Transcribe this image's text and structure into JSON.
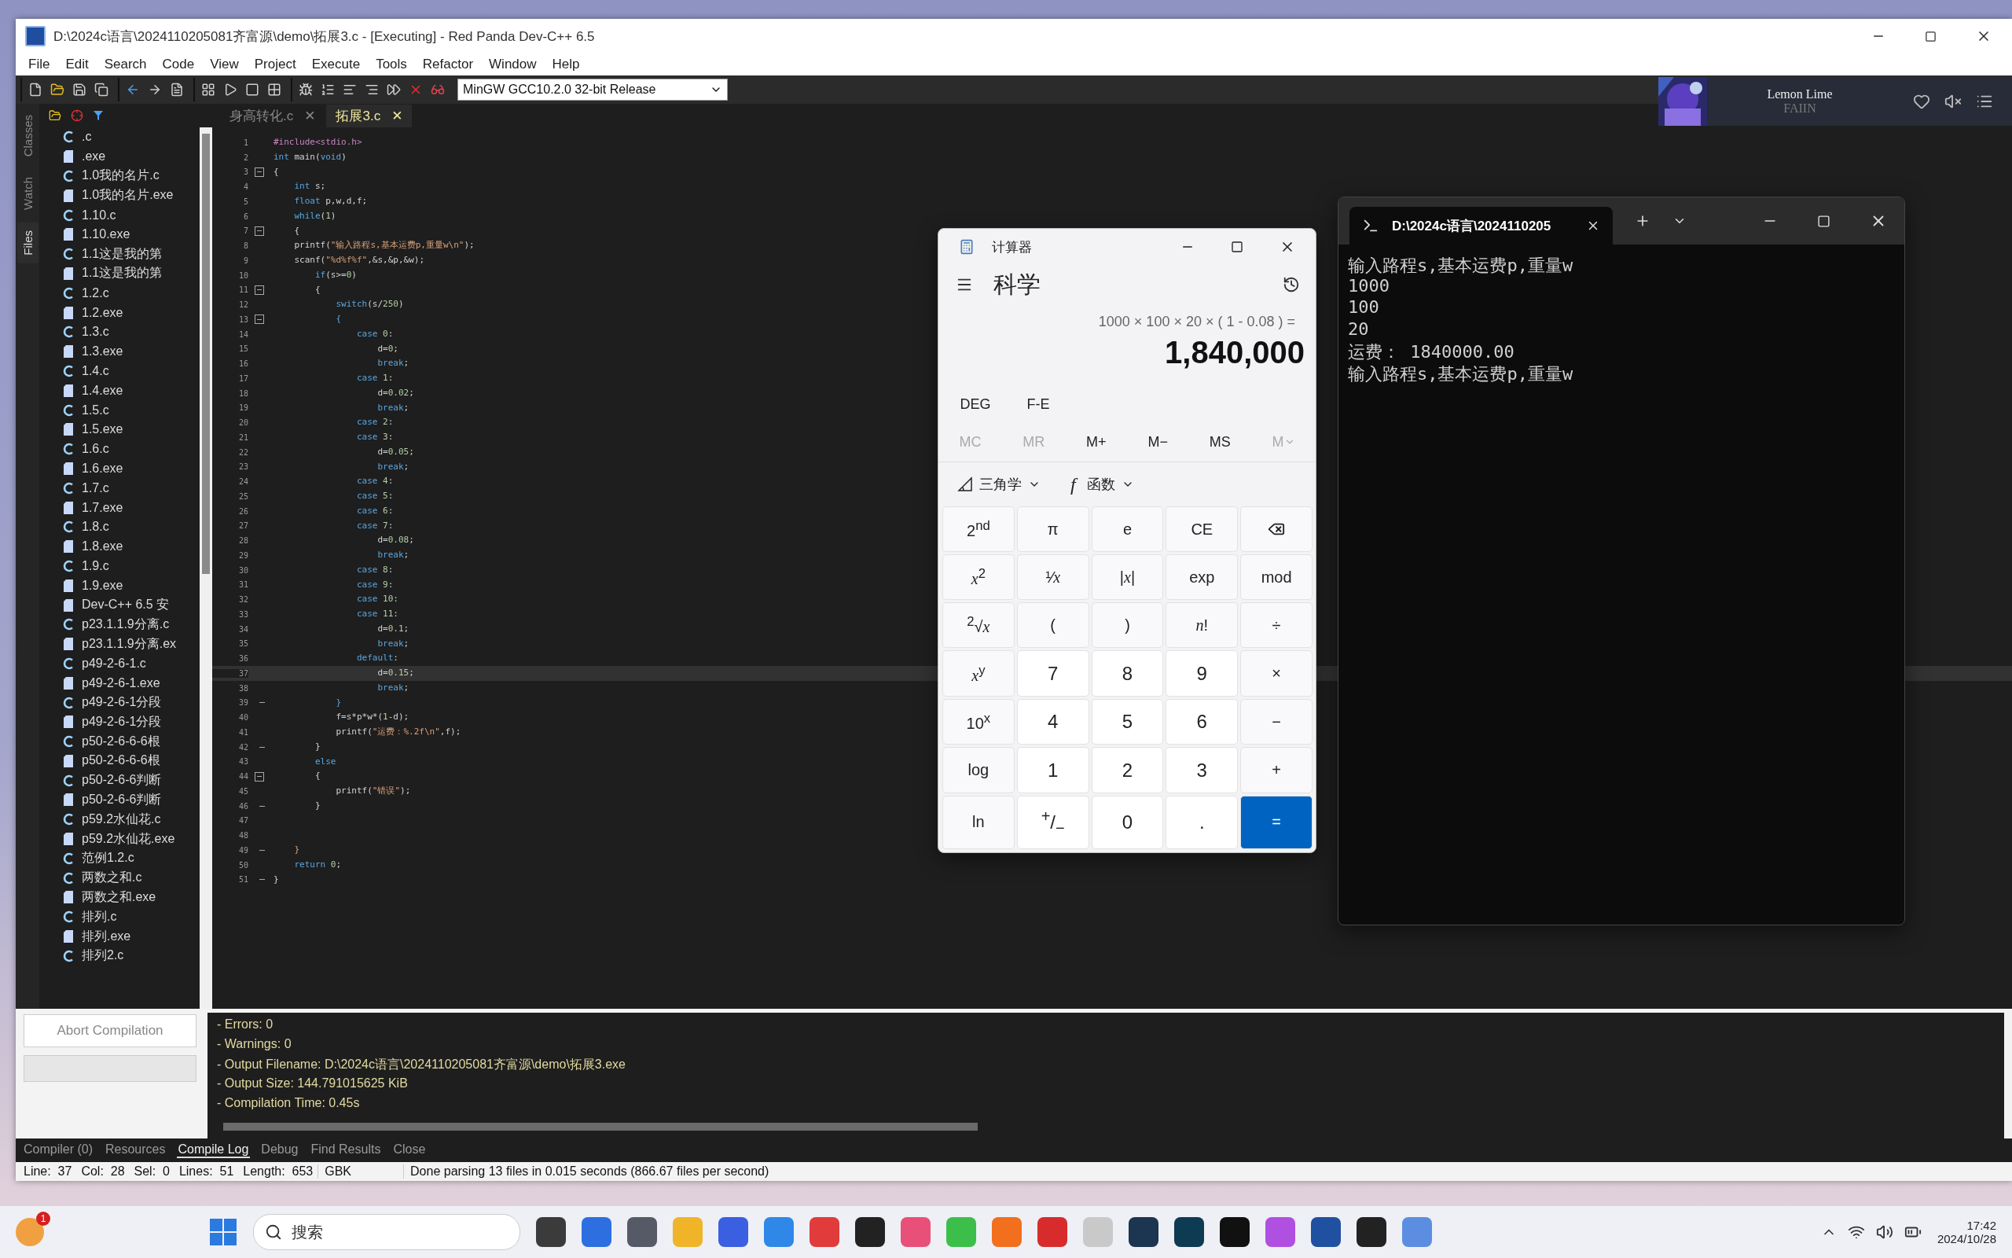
{
  "window": {
    "title": "D:\\2024c语言\\2024110205081齐富源\\demo\\拓展3.c - [Executing] - Red Panda Dev-C++ 6.5"
  },
  "menu": [
    "File",
    "Edit",
    "Search",
    "Code",
    "View",
    "Project",
    "Execute",
    "Tools",
    "Refactor",
    "Window",
    "Help"
  ],
  "compiler_select": {
    "value": "MinGW GCC10.2.0 32-bit Release"
  },
  "music_widget": {
    "title": "Lemon Lime",
    "artist": "FAIIN",
    "liked": false,
    "muted": true
  },
  "side_tabs": [
    {
      "label": "Classes",
      "selected": false
    },
    {
      "label": "Watch",
      "selected": false
    },
    {
      "label": "Files",
      "selected": true
    }
  ],
  "files": [
    {
      "kind": "c",
      "name": ".c"
    },
    {
      "kind": "exe",
      "name": ".exe"
    },
    {
      "kind": "c",
      "name": "1.0我的名片.c"
    },
    {
      "kind": "exe",
      "name": "1.0我的名片.exe"
    },
    {
      "kind": "c",
      "name": "1.10.c"
    },
    {
      "kind": "exe",
      "name": "1.10.exe"
    },
    {
      "kind": "c",
      "name": "1.1这是我的第"
    },
    {
      "kind": "exe",
      "name": "1.1这是我的第"
    },
    {
      "kind": "c",
      "name": "1.2.c"
    },
    {
      "kind": "exe",
      "name": "1.2.exe"
    },
    {
      "kind": "c",
      "name": "1.3.c"
    },
    {
      "kind": "exe",
      "name": "1.3.exe"
    },
    {
      "kind": "c",
      "name": "1.4.c"
    },
    {
      "kind": "exe",
      "name": "1.4.exe"
    },
    {
      "kind": "c",
      "name": "1.5.c"
    },
    {
      "kind": "exe",
      "name": "1.5.exe"
    },
    {
      "kind": "c",
      "name": "1.6.c"
    },
    {
      "kind": "exe",
      "name": "1.6.exe"
    },
    {
      "kind": "c",
      "name": "1.7.c"
    },
    {
      "kind": "exe",
      "name": "1.7.exe"
    },
    {
      "kind": "c",
      "name": "1.8.c"
    },
    {
      "kind": "exe",
      "name": "1.8.exe"
    },
    {
      "kind": "c",
      "name": "1.9.c"
    },
    {
      "kind": "exe",
      "name": "1.9.exe"
    },
    {
      "kind": "exe",
      "name": "Dev-C++ 6.5 安"
    },
    {
      "kind": "c",
      "name": "p23.1.1.9分离.c"
    },
    {
      "kind": "exe",
      "name": "p23.1.1.9分离.ex"
    },
    {
      "kind": "c",
      "name": "p49-2-6-1.c"
    },
    {
      "kind": "exe",
      "name": "p49-2-6-1.exe"
    },
    {
      "kind": "c",
      "name": "p49-2-6-1分段"
    },
    {
      "kind": "exe",
      "name": "p49-2-6-1分段"
    },
    {
      "kind": "c",
      "name": "p50-2-6-6-6根"
    },
    {
      "kind": "exe",
      "name": "p50-2-6-6-6根"
    },
    {
      "kind": "c",
      "name": "p50-2-6-6判断"
    },
    {
      "kind": "exe",
      "name": "p50-2-6-6判断"
    },
    {
      "kind": "c",
      "name": "p59.2水仙花.c"
    },
    {
      "kind": "exe",
      "name": "p59.2水仙花.exe"
    },
    {
      "kind": "c",
      "name": "范例1.2.c"
    },
    {
      "kind": "c",
      "name": "两数之和.c"
    },
    {
      "kind": "exe",
      "name": "两数之和.exe"
    },
    {
      "kind": "c",
      "name": "排列.c"
    },
    {
      "kind": "exe",
      "name": "排列.exe"
    },
    {
      "kind": "c",
      "name": "排列2.c"
    }
  ],
  "editor_tabs": [
    {
      "label": "身高转化.c",
      "close": "✕",
      "selected": false
    },
    {
      "label": "拓展3.c",
      "close": "✕",
      "selected": true
    }
  ],
  "code": [
    {
      "n": "1",
      "kind": "plain",
      "current": false,
      "segs": [
        {
          "kind": "preprocessor",
          "text": "#include<stdio.h>"
        }
      ]
    },
    {
      "n": "2",
      "kind": "plain",
      "current": false,
      "segs": [
        {
          "kind": "keyword",
          "text": "int"
        },
        {
          "kind": "plain",
          "text": " main("
        },
        {
          "kind": "keyword",
          "text": "void"
        },
        {
          "kind": "plain",
          "text": ")"
        }
      ]
    },
    {
      "n": "3",
      "kind": "fold_start",
      "current": false,
      "segs": [
        {
          "kind": "plain",
          "text": "{"
        }
      ]
    },
    {
      "n": "4",
      "kind": "plain",
      "current": false,
      "segs": [
        {
          "kind": "keyword",
          "text": "    int"
        },
        {
          "kind": "plain",
          "text": " s;"
        }
      ]
    },
    {
      "n": "5",
      "kind": "plain",
      "current": false,
      "segs": [
        {
          "kind": "keyword",
          "text": "    float"
        },
        {
          "kind": "plain",
          "text": " p,w,d,f;"
        }
      ]
    },
    {
      "n": "6",
      "kind": "plain",
      "current": false,
      "segs": [
        {
          "kind": "keyword",
          "text": "    while"
        },
        {
          "kind": "plain",
          "text": "("
        },
        {
          "kind": "number",
          "text": "1"
        },
        {
          "kind": "plain",
          "text": ")"
        }
      ]
    },
    {
      "n": "7",
      "kind": "fold_start",
      "current": false,
      "segs": [
        {
          "kind": "plain",
          "text": "    {"
        }
      ]
    },
    {
      "n": "8",
      "kind": "plain",
      "current": false,
      "segs": [
        {
          "kind": "plain",
          "text": "    printf("
        },
        {
          "kind": "string",
          "text": "\"输入路程s,基本运费p,重量w\\n\""
        },
        {
          "kind": "plain",
          "text": ");"
        }
      ]
    },
    {
      "n": "9",
      "kind": "plain",
      "current": false,
      "segs": [
        {
          "kind": "plain",
          "text": "    scanf("
        },
        {
          "kind": "string",
          "text": "\"%d%f%f\""
        },
        {
          "kind": "plain",
          "text": ",&s,&p,&w);"
        }
      ]
    },
    {
      "n": "10",
      "kind": "plain",
      "current": false,
      "segs": [
        {
          "kind": "keyword",
          "text": "        if"
        },
        {
          "kind": "plain",
          "text": "(s>="
        },
        {
          "kind": "number",
          "text": "0"
        },
        {
          "kind": "plain",
          "text": ")"
        }
      ]
    },
    {
      "n": "11",
      "kind": "fold_start",
      "current": false,
      "segs": [
        {
          "kind": "plain",
          "text": "        {"
        }
      ]
    },
    {
      "n": "12",
      "kind": "plain",
      "current": false,
      "segs": [
        {
          "kind": "keyword",
          "text": "            switch"
        },
        {
          "kind": "plain",
          "text": "(s/"
        },
        {
          "kind": "number",
          "text": "250"
        },
        {
          "kind": "plain",
          "text": ")"
        }
      ]
    },
    {
      "n": "13",
      "kind": "fold_start",
      "current": false,
      "segs": [
        {
          "kind": "keyword",
          "text": "            {"
        }
      ]
    },
    {
      "n": "14",
      "kind": "plain",
      "current": false,
      "segs": [
        {
          "kind": "keyword",
          "text": "                case"
        },
        {
          "kind": "number",
          "text": " 0"
        },
        {
          "kind": "plain",
          "text": ":"
        }
      ]
    },
    {
      "n": "15",
      "kind": "plain",
      "current": false,
      "segs": [
        {
          "kind": "plain",
          "text": "                    d="
        },
        {
          "kind": "number",
          "text": "0"
        },
        {
          "kind": "plain",
          "text": ";"
        }
      ]
    },
    {
      "n": "16",
      "kind": "plain",
      "current": false,
      "segs": [
        {
          "kind": "keyword",
          "text": "                    break"
        },
        {
          "kind": "plain",
          "text": ";"
        }
      ]
    },
    {
      "n": "17",
      "kind": "plain",
      "current": false,
      "segs": [
        {
          "kind": "keyword",
          "text": "                case"
        },
        {
          "kind": "number",
          "text": " 1"
        },
        {
          "kind": "plain",
          "text": ":"
        }
      ]
    },
    {
      "n": "18",
      "kind": "plain",
      "current": false,
      "segs": [
        {
          "kind": "plain",
          "text": "                    d="
        },
        {
          "kind": "number",
          "text": "0.02"
        },
        {
          "kind": "plain",
          "text": ";"
        }
      ]
    },
    {
      "n": "19",
      "kind": "plain",
      "current": false,
      "segs": [
        {
          "kind": "keyword",
          "text": "                    break"
        },
        {
          "kind": "plain",
          "text": ";"
        }
      ]
    },
    {
      "n": "20",
      "kind": "plain",
      "current": false,
      "segs": [
        {
          "kind": "keyword",
          "text": "                case"
        },
        {
          "kind": "number",
          "text": " 2"
        },
        {
          "kind": "plain",
          "text": ":"
        }
      ]
    },
    {
      "n": "21",
      "kind": "plain",
      "current": false,
      "segs": [
        {
          "kind": "keyword",
          "text": "                case"
        },
        {
          "kind": "number",
          "text": " 3"
        },
        {
          "kind": "plain",
          "text": ":"
        }
      ]
    },
    {
      "n": "22",
      "kind": "plain",
      "current": false,
      "segs": [
        {
          "kind": "plain",
          "text": "                    d="
        },
        {
          "kind": "number",
          "text": "0.05"
        },
        {
          "kind": "plain",
          "text": ";"
        }
      ]
    },
    {
      "n": "23",
      "kind": "plain",
      "current": false,
      "segs": [
        {
          "kind": "keyword",
          "text": "                    break"
        },
        {
          "kind": "plain",
          "text": ";"
        }
      ]
    },
    {
      "n": "24",
      "kind": "plain",
      "current": false,
      "segs": [
        {
          "kind": "keyword",
          "text": "                case"
        },
        {
          "kind": "number",
          "text": " 4"
        },
        {
          "kind": "plain",
          "text": ":"
        }
      ]
    },
    {
      "n": "25",
      "kind": "plain",
      "current": false,
      "segs": [
        {
          "kind": "keyword",
          "text": "                case"
        },
        {
          "kind": "number",
          "text": " 5"
        },
        {
          "kind": "plain",
          "text": ":"
        }
      ]
    },
    {
      "n": "26",
      "kind": "plain",
      "current": false,
      "segs": [
        {
          "kind": "keyword",
          "text": "                case"
        },
        {
          "kind": "number",
          "text": " 6"
        },
        {
          "kind": "plain",
          "text": ":"
        }
      ]
    },
    {
      "n": "27",
      "kind": "plain",
      "current": false,
      "segs": [
        {
          "kind": "keyword",
          "text": "                case"
        },
        {
          "kind": "number",
          "text": " 7"
        },
        {
          "kind": "plain",
          "text": ":"
        }
      ]
    },
    {
      "n": "28",
      "kind": "plain",
      "current": false,
      "segs": [
        {
          "kind": "plain",
          "text": "                    d="
        },
        {
          "kind": "number",
          "text": "0.08"
        },
        {
          "kind": "plain",
          "text": ";"
        }
      ]
    },
    {
      "n": "29",
      "kind": "plain",
      "current": false,
      "segs": [
        {
          "kind": "keyword",
          "text": "                    break"
        },
        {
          "kind": "plain",
          "text": ";"
        }
      ]
    },
    {
      "n": "30",
      "kind": "plain",
      "current": false,
      "segs": [
        {
          "kind": "keyword",
          "text": "                case"
        },
        {
          "kind": "number",
          "text": " 8"
        },
        {
          "kind": "plain",
          "text": ":"
        }
      ]
    },
    {
      "n": "31",
      "kind": "plain",
      "current": false,
      "segs": [
        {
          "kind": "keyword",
          "text": "                case"
        },
        {
          "kind": "number",
          "text": " 9"
        },
        {
          "kind": "plain",
          "text": ":"
        }
      ]
    },
    {
      "n": "32",
      "kind": "plain",
      "current": false,
      "segs": [
        {
          "kind": "keyword",
          "text": "                case"
        },
        {
          "kind": "number",
          "text": " 10"
        },
        {
          "kind": "plain",
          "text": ":"
        }
      ]
    },
    {
      "n": "33",
      "kind": "plain",
      "current": false,
      "segs": [
        {
          "kind": "keyword",
          "text": "                case"
        },
        {
          "kind": "number",
          "text": " 11"
        },
        {
          "kind": "plain",
          "text": ":"
        }
      ]
    },
    {
      "n": "34",
      "kind": "plain",
      "current": false,
      "segs": [
        {
          "kind": "plain",
          "text": "                    d="
        },
        {
          "kind": "number",
          "text": "0.1"
        },
        {
          "kind": "plain",
          "text": ";"
        }
      ]
    },
    {
      "n": "35",
      "kind": "plain",
      "current": false,
      "segs": [
        {
          "kind": "keyword",
          "text": "                    break"
        },
        {
          "kind": "plain",
          "text": ";"
        }
      ]
    },
    {
      "n": "36",
      "kind": "plain",
      "current": false,
      "segs": [
        {
          "kind": "keyword",
          "text": "                default"
        },
        {
          "kind": "plain",
          "text": ":"
        }
      ]
    },
    {
      "n": "37",
      "kind": "plain",
      "current": true,
      "segs": [
        {
          "kind": "plain",
          "text": "                    d="
        },
        {
          "kind": "number",
          "text": "0.15"
        },
        {
          "kind": "plain",
          "text": ";"
        }
      ]
    },
    {
      "n": "38",
      "kind": "plain",
      "current": false,
      "segs": [
        {
          "kind": "keyword",
          "text": "                    break"
        },
        {
          "kind": "plain",
          "text": ";"
        }
      ]
    },
    {
      "n": "39",
      "kind": "fold_end",
      "current": false,
      "segs": [
        {
          "kind": "keyword",
          "text": "            }"
        }
      ]
    },
    {
      "n": "40",
      "kind": "plain",
      "current": false,
      "segs": [
        {
          "kind": "plain",
          "text": "            f=s*p*w*("
        },
        {
          "kind": "number",
          "text": "1"
        },
        {
          "kind": "plain",
          "text": "-d);"
        }
      ]
    },
    {
      "n": "41",
      "kind": "plain",
      "current": false,
      "segs": [
        {
          "kind": "plain",
          "text": "            printf("
        },
        {
          "kind": "string",
          "text": "\"运费：%.2f\\n\""
        },
        {
          "kind": "plain",
          "text": ",f);"
        }
      ]
    },
    {
      "n": "42",
      "kind": "fold_end",
      "current": false,
      "segs": [
        {
          "kind": "plain",
          "text": "        }"
        }
      ]
    },
    {
      "n": "43",
      "kind": "plain",
      "current": false,
      "segs": [
        {
          "kind": "keyword",
          "text": "        else"
        }
      ]
    },
    {
      "n": "44",
      "kind": "fold_start",
      "current": false,
      "segs": [
        {
          "kind": "plain",
          "text": "        {"
        }
      ]
    },
    {
      "n": "45",
      "kind": "plain",
      "current": false,
      "segs": [
        {
          "kind": "plain",
          "text": "            printf("
        },
        {
          "kind": "string",
          "text": "\"错误\""
        },
        {
          "kind": "plain",
          "text": ");"
        }
      ]
    },
    {
      "n": "46",
      "kind": "fold_end",
      "current": false,
      "segs": [
        {
          "kind": "plain",
          "text": "        }"
        }
      ]
    },
    {
      "n": "47",
      "kind": "plain",
      "current": false
    },
    {
      "n": "48",
      "kind": "plain",
      "current": false
    },
    {
      "n": "49",
      "kind": "fold_end",
      "current": false,
      "segs": [
        {
          "kind": "string",
          "text": "    }"
        }
      ]
    },
    {
      "n": "50",
      "kind": "plain",
      "current": false,
      "segs": [
        {
          "kind": "keyword",
          "text": "    return"
        },
        {
          "kind": "number",
          "text": " 0"
        },
        {
          "kind": "plain",
          "text": ";"
        }
      ]
    },
    {
      "n": "51",
      "kind": "fold_end",
      "current": false,
      "segs": [
        {
          "kind": "plain",
          "text": "}"
        }
      ]
    }
  ],
  "abort_button": {
    "label": "Abort Compilation",
    "disabled": true
  },
  "compile_log": [
    "- Errors: 0",
    "- Warnings: 0",
    "- Output Filename: D:\\2024c语言\\2024110205081齐富源\\demo\\拓展3.exe",
    "- Output Size: 144.791015625 KiB",
    "- Compilation Time: 0.45s"
  ],
  "bottom_tabs": [
    {
      "label": "Compiler (0)",
      "selected": false
    },
    {
      "label": "Resources",
      "selected": false
    },
    {
      "label": "Compile Log",
      "selected": true
    },
    {
      "label": "Debug",
      "selected": false
    },
    {
      "label": "Find Results",
      "selected": false
    },
    {
      "label": "Close",
      "selected": false
    }
  ],
  "status_bar": {
    "fields": [
      {
        "label": "Line:",
        "value": "37"
      },
      {
        "label": "Col:",
        "value": "28"
      },
      {
        "label": "Sel:",
        "value": "0"
      },
      {
        "label": "Lines:",
        "value": "51"
      },
      {
        "label": "Length:",
        "value": "653"
      }
    ],
    "encoding": "GBK",
    "message": "Done parsing 13 files in 0.015 seconds (866.67 files per second)"
  },
  "calculator": {
    "title": "计算器",
    "mode": "科学",
    "expression": "1000 × 100 × 20 × ( 1 - 0.08 ) =",
    "result": "1,840,000",
    "options": [
      "DEG",
      "F-E"
    ],
    "memory": [
      {
        "label": "MC",
        "kind": "plain",
        "disabled": true
      },
      {
        "label": "MR",
        "kind": "plain",
        "disabled": true
      },
      {
        "label": "M+",
        "kind": "plain",
        "disabled": false
      },
      {
        "label": "M−",
        "kind": "plain",
        "disabled": false
      },
      {
        "label": "MS",
        "kind": "plain",
        "disabled": false
      },
      {
        "label": "M",
        "kind": "menu",
        "disabled": true
      }
    ],
    "dropdowns": [
      {
        "kind": "trig",
        "label": "三角学"
      },
      {
        "kind": "func",
        "glyph": "f",
        "label": "函数"
      }
    ],
    "keys": [
      {
        "kind": "fn",
        "label": "2$^{nd}$"
      },
      {
        "kind": "fn",
        "label": "π"
      },
      {
        "kind": "fn",
        "label": "e"
      },
      {
        "kind": "fn",
        "label": "CE"
      },
      {
        "kind": "backspace"
      },
      {
        "kind": "fn",
        "label": "*x*$^{2}$"
      },
      {
        "kind": "fn",
        "label": "¹⁄*x*"
      },
      {
        "kind": "fn",
        "label": "|*x*|"
      },
      {
        "kind": "fn",
        "label": "exp"
      },
      {
        "kind": "fn",
        "label": "mod"
      },
      {
        "kind": "fn",
        "label": "$^{2}$√*x*"
      },
      {
        "kind": "fn",
        "label": "("
      },
      {
        "kind": "fn",
        "label": ")"
      },
      {
        "kind": "fn",
        "label": "*n*!"
      },
      {
        "kind": "fn",
        "label": "÷"
      },
      {
        "kind": "fn",
        "label": "*x*$^{y}$"
      },
      {
        "kind": "num",
        "label": "7"
      },
      {
        "kind": "num",
        "label": "8"
      },
      {
        "kind": "num",
        "label": "9"
      },
      {
        "kind": "fn",
        "label": "×"
      },
      {
        "kind": "fn",
        "label": "10$^{x}$"
      },
      {
        "kind": "num",
        "label": "4"
      },
      {
        "kind": "num",
        "label": "5"
      },
      {
        "kind": "num",
        "label": "6"
      },
      {
        "kind": "fn",
        "label": "−"
      },
      {
        "kind": "fn",
        "label": "log"
      },
      {
        "kind": "num",
        "label": "1"
      },
      {
        "kind": "num",
        "label": "2"
      },
      {
        "kind": "num",
        "label": "3"
      },
      {
        "kind": "fn",
        "label": "+"
      },
      {
        "kind": "fn",
        "label": "ln"
      },
      {
        "kind": "num",
        "label": "$^{+}$/$_{−}$"
      },
      {
        "kind": "num",
        "label": "0"
      },
      {
        "kind": "num",
        "label": "."
      },
      {
        "kind": "equals",
        "label": "="
      }
    ]
  },
  "terminal": {
    "tab_title": "D:\\2024c语言\\2024110205",
    "lines": [
      "输入路程s,基本运费p,重量w",
      "1000",
      "100",
      "20",
      "运费： 1840000.00",
      "输入路程s,基本运费p,重量w"
    ]
  },
  "taskbar": {
    "weather_badge": "1",
    "search": {
      "placeholder": "搜索"
    },
    "time": "17:42",
    "date": "2024/10/28"
  }
}
